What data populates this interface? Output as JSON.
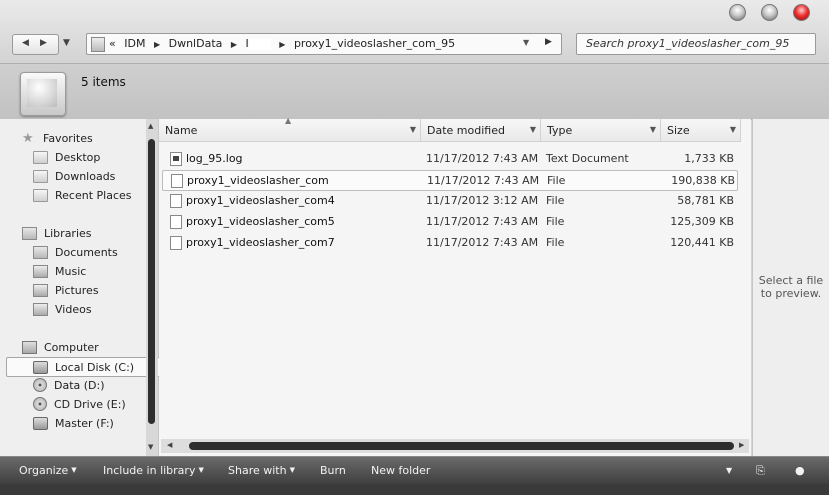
{
  "address": {
    "overflow": "«",
    "crumbs": [
      "IDM",
      "DwnlData",
      "I",
      "proxy1_videoslasher_com_95"
    ]
  },
  "search": {
    "placeholder": "Search proxy1_videoslasher_com_95"
  },
  "details": {
    "item_count": "5 items"
  },
  "nav": {
    "favorites": {
      "label": "Favorites",
      "items": [
        "Desktop",
        "Downloads",
        "Recent Places"
      ]
    },
    "libraries": {
      "label": "Libraries",
      "items": [
        "Documents",
        "Music",
        "Pictures",
        "Videos"
      ]
    },
    "computer": {
      "label": "Computer",
      "items": [
        "Local Disk (C:)",
        "Data (D:)",
        "CD Drive (E:)",
        "Master (F:)"
      ],
      "selected": "Local Disk (C:)"
    }
  },
  "columns": {
    "name": "Name",
    "date": "Date modified",
    "type": "Type",
    "size": "Size"
  },
  "files": [
    {
      "name": "log_95.log",
      "date": "11/17/2012 7:43 AM",
      "type": "Text Document",
      "size": "1,733 KB",
      "icon": "log-file-icon"
    },
    {
      "name": "proxy1_videoslasher_com",
      "date": "11/17/2012 7:43 AM",
      "type": "File",
      "size": "190,838 KB",
      "icon": "file-icon",
      "selected": true
    },
    {
      "name": "proxy1_videoslasher_com4",
      "date": "11/17/2012 3:12 AM",
      "type": "File",
      "size": "58,781 KB",
      "icon": "file-icon"
    },
    {
      "name": "proxy1_videoslasher_com5",
      "date": "11/17/2012 7:43 AM",
      "type": "File",
      "size": "125,309 KB",
      "icon": "file-icon"
    },
    {
      "name": "proxy1_videoslasher_com7",
      "date": "11/17/2012 7:43 AM",
      "type": "File",
      "size": "120,441 KB",
      "icon": "file-icon"
    }
  ],
  "preview": {
    "text": "Select a file to preview."
  },
  "toolbar": {
    "organize": "Organize",
    "include": "Include in library",
    "share": "Share with",
    "burn": "Burn",
    "new_folder": "New folder"
  }
}
